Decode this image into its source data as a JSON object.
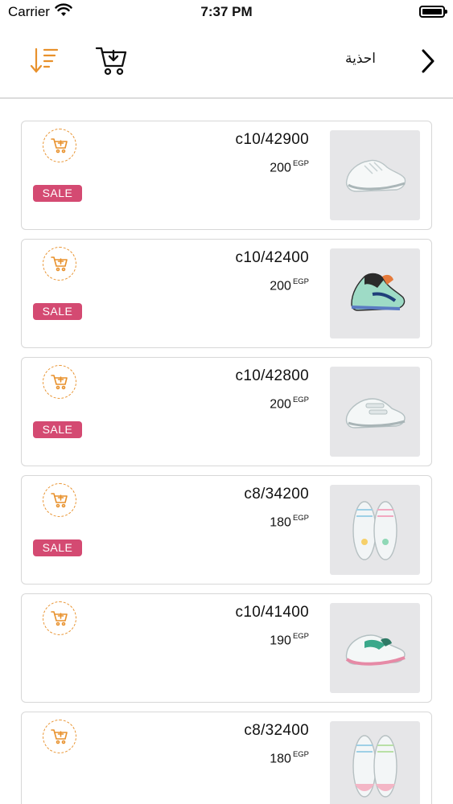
{
  "status_bar": {
    "carrier": "Carrier",
    "time": "7:37 PM"
  },
  "nav": {
    "title": "احذية",
    "icons": [
      "sort-descending-icon",
      "cart-download-icon",
      "chevron-right-icon"
    ]
  },
  "colors": {
    "accent": "#e8912c",
    "sale": "#d44a72",
    "border": "#d7d7d7",
    "thumb_bg": "#e6e6e8"
  },
  "products": [
    {
      "code": "c10/42900",
      "price": "200",
      "currency": "EGP",
      "sale": true,
      "sale_label": "SALE",
      "image": "white-chunky-sneaker"
    },
    {
      "code": "c10/42400",
      "price": "200",
      "currency": "EGP",
      "sale": true,
      "sale_label": "SALE",
      "image": "mint-black-high-top-sneaker"
    },
    {
      "code": "c10/42800",
      "price": "200",
      "currency": "EGP",
      "sale": true,
      "sale_label": "SALE",
      "image": "white-velcro-sneaker"
    },
    {
      "code": "c8/34200",
      "price": "180",
      "currency": "EGP",
      "sale": true,
      "sale_label": "SALE",
      "image": "white-pastel-kids-sneakers-pair"
    },
    {
      "code": "c10/41400",
      "price": "190",
      "currency": "EGP",
      "sale": false,
      "image": "white-green-pink-sneaker"
    },
    {
      "code": "c8/32400",
      "price": "180",
      "currency": "EGP",
      "sale": false,
      "image": "white-pastel-sneakers-pair"
    }
  ]
}
